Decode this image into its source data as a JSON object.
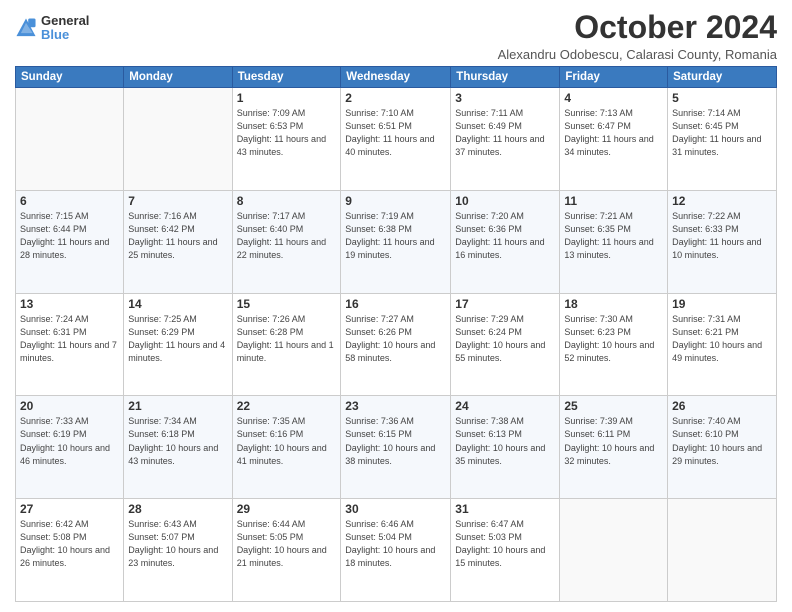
{
  "logo": {
    "general": "General",
    "blue": "Blue"
  },
  "title": "October 2024",
  "location": "Alexandru Odobescu, Calarasi County, Romania",
  "days_of_week": [
    "Sunday",
    "Monday",
    "Tuesday",
    "Wednesday",
    "Thursday",
    "Friday",
    "Saturday"
  ],
  "weeks": [
    [
      {
        "day": "",
        "sunrise": "",
        "sunset": "",
        "daylight": ""
      },
      {
        "day": "",
        "sunrise": "",
        "sunset": "",
        "daylight": ""
      },
      {
        "day": "1",
        "sunrise": "Sunrise: 7:09 AM",
        "sunset": "Sunset: 6:53 PM",
        "daylight": "Daylight: 11 hours and 43 minutes."
      },
      {
        "day": "2",
        "sunrise": "Sunrise: 7:10 AM",
        "sunset": "Sunset: 6:51 PM",
        "daylight": "Daylight: 11 hours and 40 minutes."
      },
      {
        "day": "3",
        "sunrise": "Sunrise: 7:11 AM",
        "sunset": "Sunset: 6:49 PM",
        "daylight": "Daylight: 11 hours and 37 minutes."
      },
      {
        "day": "4",
        "sunrise": "Sunrise: 7:13 AM",
        "sunset": "Sunset: 6:47 PM",
        "daylight": "Daylight: 11 hours and 34 minutes."
      },
      {
        "day": "5",
        "sunrise": "Sunrise: 7:14 AM",
        "sunset": "Sunset: 6:45 PM",
        "daylight": "Daylight: 11 hours and 31 minutes."
      }
    ],
    [
      {
        "day": "6",
        "sunrise": "Sunrise: 7:15 AM",
        "sunset": "Sunset: 6:44 PM",
        "daylight": "Daylight: 11 hours and 28 minutes."
      },
      {
        "day": "7",
        "sunrise": "Sunrise: 7:16 AM",
        "sunset": "Sunset: 6:42 PM",
        "daylight": "Daylight: 11 hours and 25 minutes."
      },
      {
        "day": "8",
        "sunrise": "Sunrise: 7:17 AM",
        "sunset": "Sunset: 6:40 PM",
        "daylight": "Daylight: 11 hours and 22 minutes."
      },
      {
        "day": "9",
        "sunrise": "Sunrise: 7:19 AM",
        "sunset": "Sunset: 6:38 PM",
        "daylight": "Daylight: 11 hours and 19 minutes."
      },
      {
        "day": "10",
        "sunrise": "Sunrise: 7:20 AM",
        "sunset": "Sunset: 6:36 PM",
        "daylight": "Daylight: 11 hours and 16 minutes."
      },
      {
        "day": "11",
        "sunrise": "Sunrise: 7:21 AM",
        "sunset": "Sunset: 6:35 PM",
        "daylight": "Daylight: 11 hours and 13 minutes."
      },
      {
        "day": "12",
        "sunrise": "Sunrise: 7:22 AM",
        "sunset": "Sunset: 6:33 PM",
        "daylight": "Daylight: 11 hours and 10 minutes."
      }
    ],
    [
      {
        "day": "13",
        "sunrise": "Sunrise: 7:24 AM",
        "sunset": "Sunset: 6:31 PM",
        "daylight": "Daylight: 11 hours and 7 minutes."
      },
      {
        "day": "14",
        "sunrise": "Sunrise: 7:25 AM",
        "sunset": "Sunset: 6:29 PM",
        "daylight": "Daylight: 11 hours and 4 minutes."
      },
      {
        "day": "15",
        "sunrise": "Sunrise: 7:26 AM",
        "sunset": "Sunset: 6:28 PM",
        "daylight": "Daylight: 11 hours and 1 minute."
      },
      {
        "day": "16",
        "sunrise": "Sunrise: 7:27 AM",
        "sunset": "Sunset: 6:26 PM",
        "daylight": "Daylight: 10 hours and 58 minutes."
      },
      {
        "day": "17",
        "sunrise": "Sunrise: 7:29 AM",
        "sunset": "Sunset: 6:24 PM",
        "daylight": "Daylight: 10 hours and 55 minutes."
      },
      {
        "day": "18",
        "sunrise": "Sunrise: 7:30 AM",
        "sunset": "Sunset: 6:23 PM",
        "daylight": "Daylight: 10 hours and 52 minutes."
      },
      {
        "day": "19",
        "sunrise": "Sunrise: 7:31 AM",
        "sunset": "Sunset: 6:21 PM",
        "daylight": "Daylight: 10 hours and 49 minutes."
      }
    ],
    [
      {
        "day": "20",
        "sunrise": "Sunrise: 7:33 AM",
        "sunset": "Sunset: 6:19 PM",
        "daylight": "Daylight: 10 hours and 46 minutes."
      },
      {
        "day": "21",
        "sunrise": "Sunrise: 7:34 AM",
        "sunset": "Sunset: 6:18 PM",
        "daylight": "Daylight: 10 hours and 43 minutes."
      },
      {
        "day": "22",
        "sunrise": "Sunrise: 7:35 AM",
        "sunset": "Sunset: 6:16 PM",
        "daylight": "Daylight: 10 hours and 41 minutes."
      },
      {
        "day": "23",
        "sunrise": "Sunrise: 7:36 AM",
        "sunset": "Sunset: 6:15 PM",
        "daylight": "Daylight: 10 hours and 38 minutes."
      },
      {
        "day": "24",
        "sunrise": "Sunrise: 7:38 AM",
        "sunset": "Sunset: 6:13 PM",
        "daylight": "Daylight: 10 hours and 35 minutes."
      },
      {
        "day": "25",
        "sunrise": "Sunrise: 7:39 AM",
        "sunset": "Sunset: 6:11 PM",
        "daylight": "Daylight: 10 hours and 32 minutes."
      },
      {
        "day": "26",
        "sunrise": "Sunrise: 7:40 AM",
        "sunset": "Sunset: 6:10 PM",
        "daylight": "Daylight: 10 hours and 29 minutes."
      }
    ],
    [
      {
        "day": "27",
        "sunrise": "Sunrise: 6:42 AM",
        "sunset": "Sunset: 5:08 PM",
        "daylight": "Daylight: 10 hours and 26 minutes."
      },
      {
        "day": "28",
        "sunrise": "Sunrise: 6:43 AM",
        "sunset": "Sunset: 5:07 PM",
        "daylight": "Daylight: 10 hours and 23 minutes."
      },
      {
        "day": "29",
        "sunrise": "Sunrise: 6:44 AM",
        "sunset": "Sunset: 5:05 PM",
        "daylight": "Daylight: 10 hours and 21 minutes."
      },
      {
        "day": "30",
        "sunrise": "Sunrise: 6:46 AM",
        "sunset": "Sunset: 5:04 PM",
        "daylight": "Daylight: 10 hours and 18 minutes."
      },
      {
        "day": "31",
        "sunrise": "Sunrise: 6:47 AM",
        "sunset": "Sunset: 5:03 PM",
        "daylight": "Daylight: 10 hours and 15 minutes."
      },
      {
        "day": "",
        "sunrise": "",
        "sunset": "",
        "daylight": ""
      },
      {
        "day": "",
        "sunrise": "",
        "sunset": "",
        "daylight": ""
      }
    ]
  ]
}
